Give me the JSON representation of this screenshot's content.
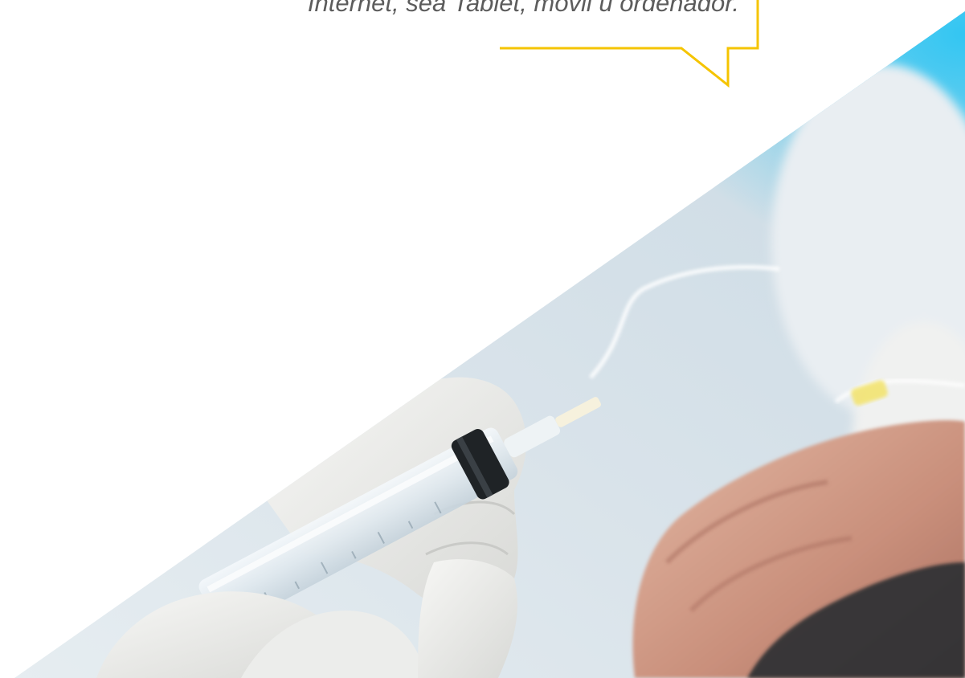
{
  "tagline": {
    "text": "Internet, sea Tablet, móvil u ordenador."
  },
  "colors": {
    "accent": "#f5c400",
    "text": "#5c5c5c",
    "background": "#ffffff"
  },
  "image": {
    "subject": "gloved hands holding a syringe next to a patient's hand with an IV line"
  }
}
